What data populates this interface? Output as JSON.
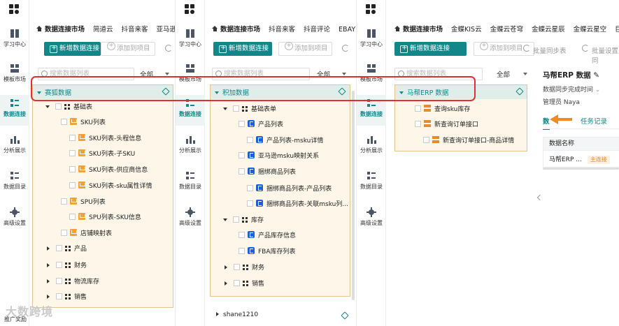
{
  "nav_items": [
    "学习中心",
    "模板市场",
    "数据连接",
    "分析展示",
    "数据目录",
    "高级设置"
  ],
  "panel1": {
    "tabs": [
      "数据连接市场",
      "简道云",
      "抖音来客",
      "亚马逊"
    ],
    "btn_new": "新增数据连接",
    "btn_add": "添加到项目",
    "search_placeholder": "搜索数据列表",
    "select": "全部",
    "tree_head": "赛狐数据",
    "rows": [
      "基础表",
      "SKU列表",
      "SKU列表-头程信息",
      "SKU列表-子SKU",
      "SKU列表-供应商信息",
      "SKU列表-sku属性详情",
      "SPU列表",
      "SPU列表-SKU信息",
      "店铺映射表",
      "产品",
      "财务",
      "物流库存",
      "销售"
    ]
  },
  "panel2": {
    "tabs": [
      "数据连接市场",
      "抖音来客",
      "抖音评论",
      "EBAY"
    ],
    "btn_new": "新增数据连接",
    "btn_add": "添加到项目",
    "search_placeholder": "搜索数据列表",
    "select": "全部",
    "tree_head": "积加数据",
    "rows": [
      "基础表单",
      "产品列表",
      "产品列表-msku详情",
      "亚马逊msku映射关系",
      "捆绑商品列表",
      "捆绑商品列表-产品列表",
      "捆绑商品列表-关联msku列...",
      "库存",
      "产品库存信息",
      "FBA库存列表",
      "财务",
      "销售"
    ],
    "bottom_item": "shane1210"
  },
  "panel3": {
    "tabs": [
      "数据连接市场",
      "金蝶KIS云",
      "金蝶云苍穹",
      "金蝶云星辰",
      "金蝶云星空",
      "巨"
    ],
    "btn_new": "新增数据连接",
    "btn_add": "添加到项目",
    "btn_batch_sync": "批量同步表",
    "btn_batch_set": "批量设置同",
    "search_placeholder": "搜索数据列表",
    "select": "全部",
    "tree_head": "马帮ERP 数据",
    "rows": [
      "查询sku库存",
      "新查询订单接口",
      "新查询订单接口-商品详情"
    ]
  },
  "detail": {
    "title": "马帮ERP 数据",
    "sync_label": "数据同步完成时间",
    "admin_label": "管理员",
    "admin_value": "Naya",
    "tab1": "数",
    "tab2": "任务记录",
    "col_name": "数据名称",
    "row_name": "马帮ERP ...",
    "row_badge": "主连接"
  },
  "watermark": "大数跨境",
  "watermark_side": "推广奖励",
  "colors": {
    "accent": "#13868a",
    "tree_bg": "#fdf6e9",
    "tree_border": "#e6c58d",
    "highlight": "#e23030",
    "arrow": "#f08a24"
  }
}
